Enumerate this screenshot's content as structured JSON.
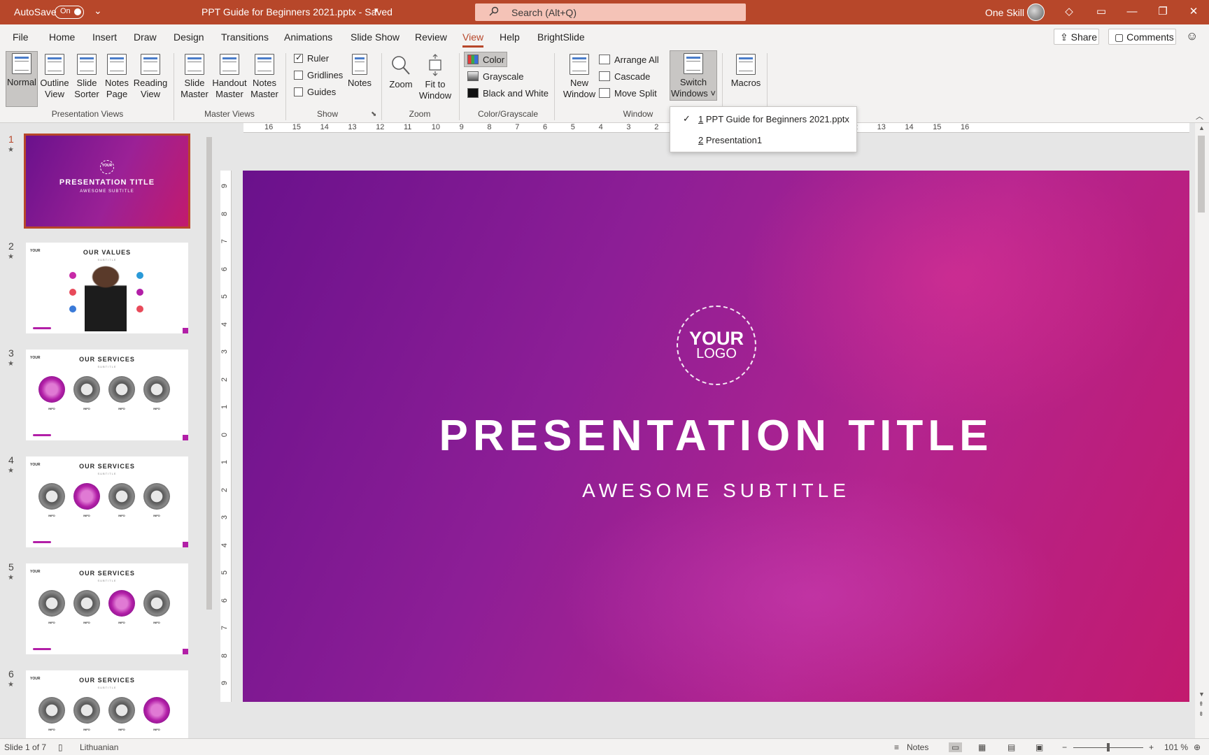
{
  "titlebar": {
    "autosave_label": "AutoSave",
    "autosave_state": "On",
    "document_title": "PPT Guide for Beginners 2021.pptx  -  Saved",
    "search_placeholder": "Search (Alt+Q)",
    "account_name": "One Skill"
  },
  "menu": {
    "items": [
      "File",
      "Home",
      "Insert",
      "Draw",
      "Design",
      "Transitions",
      "Animations",
      "Slide Show",
      "Review",
      "View",
      "Help",
      "BrightSlide"
    ],
    "active": "View",
    "share": "Share",
    "comments": "Comments"
  },
  "ribbon": {
    "presentation_views": {
      "label": "Presentation Views",
      "buttons": [
        "Normal",
        "Outline View",
        "Slide Sorter",
        "Notes Page",
        "Reading View"
      ],
      "pressed": "Normal"
    },
    "master_views": {
      "label": "Master Views",
      "buttons": [
        "Slide Master",
        "Handout Master",
        "Notes Master"
      ]
    },
    "show": {
      "label": "Show",
      "ruler": "Ruler",
      "gridlines": "Gridlines",
      "guides": "Guides",
      "notes": "Notes",
      "ruler_checked": true
    },
    "zoom": {
      "label": "Zoom",
      "zoom_btn": "Zoom",
      "fit_line1": "Fit to",
      "fit_line2": "Window"
    },
    "color": {
      "label": "Color/Grayscale",
      "color": "Color",
      "grayscale": "Grayscale",
      "bw": "Black and White"
    },
    "window": {
      "label": "Window",
      "new_line1": "New",
      "new_line2": "Window",
      "arrange": "Arrange All",
      "cascade": "Cascade",
      "move_split": "Move Split",
      "switch_line1": "Switch",
      "switch_line2": "Windows"
    },
    "macros": {
      "label": "Macros"
    }
  },
  "switch_menu": {
    "items": [
      {
        "num": "1",
        "text": "PPT Guide for Beginners 2021.pptx",
        "checked": true
      },
      {
        "num": "2",
        "text": "Presentation1",
        "checked": false
      }
    ]
  },
  "ruler": {
    "h_ticks": [
      "16",
      "15",
      "14",
      "13",
      "12",
      "11",
      "10",
      "9",
      "8",
      "7",
      "6",
      "5",
      "4",
      "3",
      "2",
      "6",
      "7",
      "8",
      "9",
      "10",
      "11",
      "12",
      "13",
      "14",
      "15",
      "16"
    ],
    "v_ticks": [
      "9",
      "8",
      "7",
      "6",
      "5",
      "4",
      "3",
      "2",
      "1",
      "0",
      "1",
      "2",
      "3",
      "4",
      "5",
      "6",
      "7",
      "8",
      "9"
    ]
  },
  "slides": [
    {
      "num": "1",
      "title": "PRESENTATION TITLE",
      "subtitle": "AWESOME SUBTITLE",
      "logo_top": "YOUR",
      "logo_bottom": "LOGO"
    },
    {
      "num": "2",
      "title": "OUR VALUES",
      "subtitle": "SUBTITLE",
      "logo": "YOUR"
    },
    {
      "num": "3",
      "title": "OUR SERVICES",
      "subtitle": "SUBTITLE",
      "logo": "YOUR",
      "highlight": 0
    },
    {
      "num": "4",
      "title": "OUR SERVICES",
      "subtitle": "SUBTITLE",
      "logo": "YOUR",
      "highlight": 1
    },
    {
      "num": "5",
      "title": "OUR SERVICES",
      "subtitle": "SUBTITLE",
      "logo": "YOUR",
      "highlight": 2
    },
    {
      "num": "6",
      "title": "OUR SERVICES",
      "subtitle": "SUBTITLE",
      "logo": "YOUR",
      "highlight": 3
    }
  ],
  "info_label": "INFO",
  "main_slide": {
    "logo_top": "YOUR",
    "logo_bottom": "LOGO",
    "title": "PRESENTATION TITLE",
    "subtitle": "AWESOME SUBTITLE"
  },
  "status": {
    "slide_info": "Slide 1 of 7",
    "language": "Lithuanian",
    "notes": "Notes",
    "zoom": "101 %"
  },
  "colors": {
    "accent": "#b7472a",
    "slide_gradient_start": "#6a118c",
    "slide_gradient_end": "#c21a6e"
  }
}
